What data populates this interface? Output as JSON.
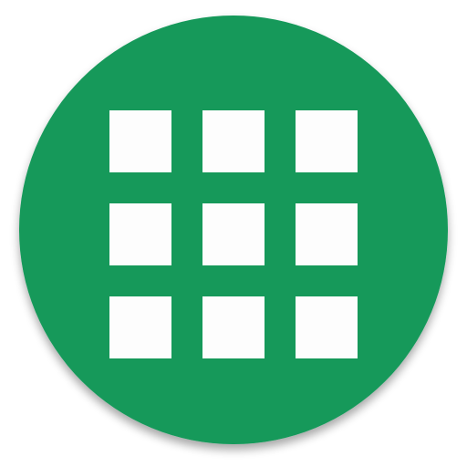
{
  "app_icon": {
    "icon_name": "app-grid-icon",
    "shape": "circle",
    "background_color": "#13995A",
    "tile_color": "#FDFDFD",
    "grid": {
      "rows": 3,
      "columns": 3
    }
  }
}
